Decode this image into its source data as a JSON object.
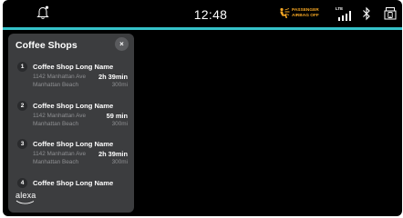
{
  "status": {
    "time": "12:48",
    "airbag_line1": "PASSENGER",
    "airbag_line2": "AIRBAG OFF",
    "network": "LTE"
  },
  "colors": {
    "accent": "#35c2c9",
    "airbag": "#f5a623",
    "panel": "#3c3d3f"
  },
  "icons": {
    "bell": "bell-icon",
    "airbag": "airbag-icon",
    "signal": "signal-icon",
    "bluetooth": "bluetooth-icon",
    "phone": "phone-icon",
    "close": "close-icon"
  },
  "panel": {
    "title": "Coffee Shops",
    "close_label": "×",
    "items": [
      {
        "number": "1",
        "name": "Coffee Shop Long Name",
        "address": "1142 Manhattan Ave",
        "city": "Manhattan Beach",
        "duration": "2h 39min",
        "distance": "300mi"
      },
      {
        "number": "2",
        "name": "Coffee Shop Long Name",
        "address": "1142 Manhattan Ave",
        "city": "Manhattan Beach",
        "duration": "59 min",
        "distance": "300mi"
      },
      {
        "number": "3",
        "name": "Coffee Shop Long Name",
        "address": "1142 Manhattan Ave",
        "city": "Manhattan Beach",
        "duration": "2h 39min",
        "distance": "300mi"
      },
      {
        "number": "4",
        "name": "Coffee Shop Long Name",
        "address": "",
        "city": "",
        "duration": "",
        "distance": ""
      }
    ],
    "alexa": "alexa"
  }
}
